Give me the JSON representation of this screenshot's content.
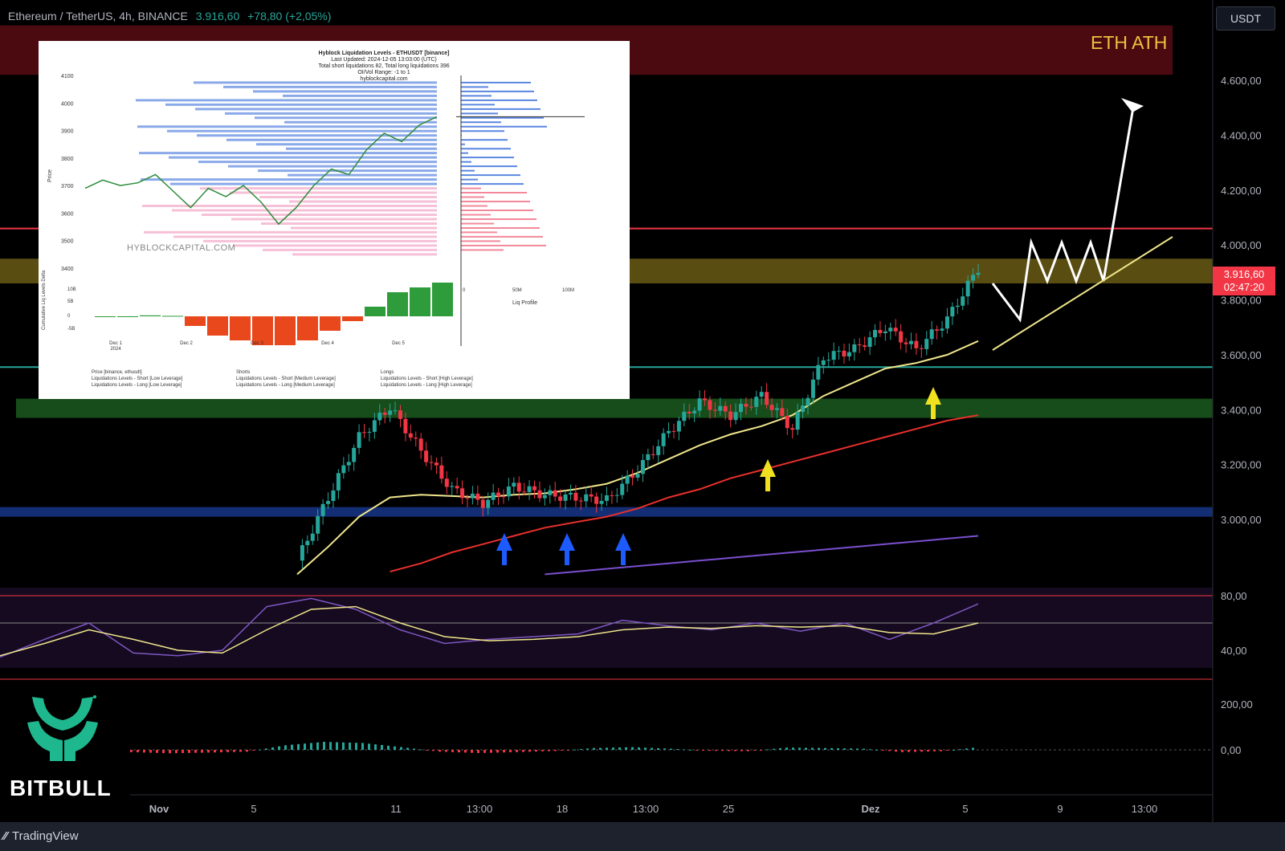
{
  "header": {
    "symbol": "Ethereum / TetherUS, 4h, BINANCE",
    "price": "3.916,60",
    "change": "+78,80 (+2,05%)"
  },
  "currency_button": "USDT",
  "annotation": {
    "ath_label": "ETH ATH"
  },
  "last_price_tag": {
    "price": "3.916,60",
    "countdown": "02:47:20"
  },
  "colors": {
    "up": "#26a69a",
    "down": "#f23645",
    "ema_fast": "#f0e68c",
    "ema_mid": "#e8302c",
    "ema_slow": "#7b4fcf",
    "ath_zone": "#4a0a10"
  },
  "brand": {
    "name": "BITBULL"
  },
  "footer": {
    "platform": "TradingView"
  },
  "chart_data": [
    {
      "type": "line",
      "title": "Ethereum / TetherUS, 4h, BINANCE",
      "price_axis": [
        "4.600,00",
        "4.400,00",
        "4.200,00",
        "4.000,00",
        "3.800,00",
        "3.600,00",
        "3.400,00",
        "3.200,00",
        "3.000,00"
      ],
      "ylim": [
        2800,
        4800
      ],
      "time_axis": [
        "Nov",
        "5",
        "11",
        "13:00",
        "18",
        "13:00",
        "25",
        "Dez",
        "5",
        "9",
        "13:00"
      ],
      "x_index": [
        0,
        6,
        12,
        18,
        24,
        30,
        36,
        42,
        48,
        54,
        60,
        66,
        72,
        78,
        84,
        90,
        96,
        102,
        108,
        114,
        120,
        126,
        132
      ],
      "series": [
        {
          "values": [
            2850,
            3080,
            3300,
            3410,
            3250,
            3110,
            3060,
            3120,
            3090,
            3080,
            3070,
            3180,
            3320,
            3430,
            3380,
            3450,
            3330,
            3590,
            3620,
            3700,
            3620,
            3730,
            3916
          ]
        },
        {
          "values": [
            2800,
            2900,
            3010,
            3080,
            3090,
            3085,
            3080,
            3090,
            3095,
            3110,
            3130,
            3170,
            3220,
            3270,
            3310,
            3340,
            3380,
            3450,
            3500,
            3550,
            3570,
            3600,
            3650
          ]
        },
        {
          "values": [
            null,
            null,
            null,
            2810,
            2840,
            2880,
            2910,
            2940,
            2970,
            2990,
            3010,
            3040,
            3080,
            3110,
            3150,
            3180,
            3210,
            3240,
            3270,
            3300,
            3330,
            3360,
            3380
          ]
        },
        {
          "values": [
            null,
            null,
            null,
            null,
            null,
            null,
            null,
            null,
            2800,
            2810,
            2820,
            2830,
            2840,
            2850,
            2860,
            2870,
            2880,
            2890,
            2900,
            2910,
            2920,
            2930,
            2940
          ]
        }
      ],
      "levels": [
        4060,
        3555
      ],
      "zones": [
        {
          "from": 3860,
          "to": 3950
        },
        {
          "from": 3370,
          "to": 3440
        },
        {
          "from": 3010,
          "to": 3045
        },
        {
          "from": 4620,
          "to": 4800
        }
      ]
    },
    {
      "type": "line",
      "price_axis": [
        "80,00",
        "40,00"
      ],
      "ylim": [
        20,
        90
      ],
      "x_index": [
        0,
        6,
        12,
        18,
        24,
        30,
        36,
        42,
        48,
        54,
        60,
        66,
        72,
        78,
        84,
        90,
        96,
        102,
        108,
        114,
        120,
        126,
        132
      ],
      "series": [
        {
          "values": [
            35,
            48,
            60,
            38,
            36,
            40,
            72,
            78,
            70,
            55,
            45,
            48,
            50,
            52,
            62,
            58,
            55,
            60,
            54,
            60,
            48,
            60,
            74
          ]
        },
        {
          "values": [
            36,
            45,
            55,
            48,
            40,
            38,
            55,
            70,
            72,
            60,
            50,
            47,
            48,
            50,
            55,
            57,
            56,
            58,
            57,
            58,
            53,
            52,
            60
          ]
        }
      ]
    },
    {
      "type": "bar",
      "price_axis": [
        "200,00",
        "0,00"
      ],
      "ylim": [
        -80,
        220
      ],
      "x_index": [
        0,
        6,
        12,
        18,
        24,
        30,
        36,
        42,
        48,
        54,
        60,
        66,
        72,
        78,
        84,
        90,
        96,
        102,
        108,
        114,
        120,
        126,
        132
      ],
      "values": [
        -10,
        -15,
        -12,
        -8,
        20,
        35,
        30,
        12,
        -8,
        -14,
        -10,
        -5,
        8,
        12,
        5,
        -4,
        -6,
        10,
        8,
        5,
        -10,
        -6,
        12
      ]
    },
    {
      "type": "line",
      "title": "Hyblock Liquidation Levels - ETHUSDT [binance]",
      "subtitle_lines": [
        "Last Updated: 2024-12-05 13:03:00 (UTC)",
        "Total short liquidations 82, Total long liquidations 396",
        "OI/Vol Range: -1 to 1",
        "hyblockcapital.com"
      ],
      "watermark": "HYBLOCKCAPITAL.COM",
      "ylabel": "Price",
      "y_ticks": [
        "4100",
        "4000",
        "3900",
        "3800",
        "3700",
        "3600",
        "3500",
        "3400"
      ],
      "x_ticks": [
        "Dec 1\n2024",
        "Dec 2",
        "Dec 3",
        "Dec 4",
        "Dec 5"
      ],
      "delta_label": "Cumulative Liq Levels Delta",
      "delta_ticks": [
        "10B",
        "5B",
        "0",
        "-5B"
      ],
      "profile_label": "Liq Profile",
      "profile_ticks": [
        "0",
        "50M",
        "100M"
      ],
      "legend": [
        "Price [binance, ethusdt]",
        "Shorts",
        "Longs",
        "Liquidations Levels - Short [Low Leverage]",
        "Liquidations Levels - Short [Medium Leverage]",
        "Liquidations Levels - Short [High Leverage]",
        "Liquidations Levels - Long [Low Leverage]",
        "Liquidations Levels - Long [Medium Leverage]",
        "Liquidations Levels - Long [High Leverage]"
      ],
      "series": [
        {
          "x": [
            0,
            1,
            2,
            3,
            4,
            5,
            6,
            7,
            8,
            9,
            10,
            11,
            12,
            13,
            14,
            15,
            16,
            17,
            18,
            19,
            20
          ],
          "values": [
            3690,
            3720,
            3700,
            3710,
            3740,
            3680,
            3620,
            3690,
            3660,
            3700,
            3640,
            3560,
            3620,
            3700,
            3760,
            3740,
            3830,
            3890,
            3860,
            3920,
            3950
          ]
        }
      ],
      "delta": [
        0,
        0,
        0.2,
        0.1,
        -2,
        -4,
        -5,
        -6,
        -6,
        -5,
        -3,
        -1,
        2,
        5,
        6,
        7
      ]
    }
  ]
}
